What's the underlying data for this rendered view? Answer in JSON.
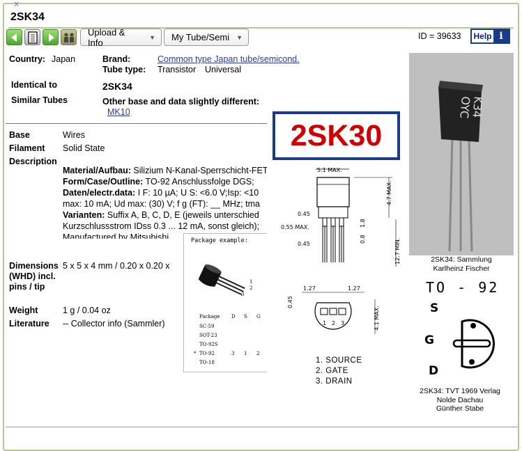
{
  "title": "2SK34",
  "nav": {
    "upload_label": "Upload & Info",
    "mytube_label": "My Tube/Semi",
    "id_text": "ID = 39633",
    "help_label": "Help",
    "help_icon_glyph": "i",
    "icons": [
      "arrow-left-icon",
      "document-icon",
      "arrow-right-icon",
      "people-icon"
    ]
  },
  "info": {
    "country_label": "Country:",
    "country_value": "Japan",
    "brand_label": "Brand:",
    "brand_value": "Common type Japan tube/semicond.",
    "tubetype_label": "Tube type:",
    "tubetype_value": "Transistor",
    "tubetype_value2": "Universal",
    "identical_label": "Identical to",
    "identical_value": "2SK34",
    "similar_label": "Similar Tubes",
    "similar_text": "Other base and data slightly different:",
    "similar_link": "MK10"
  },
  "details": {
    "base_label": "Base",
    "base_value": "Wires",
    "filament_label": "Filament",
    "filament_value": "Solid State",
    "description_label": "Description",
    "desc_lines": [
      {
        "b": "Material/Aufbau:",
        "t": " Silizium N-Kanal-Sperrschicht-FET"
      },
      {
        "b": "Form/Case/Outline:",
        "t": " TO-92 Anschlussfolge DGS;"
      },
      {
        "b": "Daten/electr.data:",
        "t": " I F: 10 µA; U S: <6.0 V;Isp: <10"
      },
      {
        "b": "",
        "t": "max: 10 mA; Ud max: (30) V; f g (FT): __ MHz; tma"
      },
      {
        "b": "Varianten:",
        "t": " Suffix A, B, C, D, E (jeweils unterschied"
      },
      {
        "b": "",
        "t": "Kurzschlussstrom IDss 0.3 ... 12 mA, sonst gleich);"
      },
      {
        "b": "",
        "t": "Manufactured by Mitsubishi"
      }
    ],
    "dimensions_label": "Dimensions (WHD) incl. pins / tip",
    "dimensions_value": "5 x 5 x 4 mm / 0.20 x 0.20 x",
    "weight_label": "Weight",
    "weight_value": "1 g / 0.04 oz",
    "literature_label": "Literature",
    "literature_value": "-- Collector info (Sammler)"
  },
  "package_example": {
    "title": "Package example:",
    "header": [
      "Package",
      "D",
      "S",
      "G"
    ],
    "rows": [
      {
        "mark": "",
        "name": "SC-59",
        "d": "",
        "s": "",
        "g": ""
      },
      {
        "mark": "",
        "name": "SOT-23",
        "d": "",
        "s": "",
        "g": ""
      },
      {
        "mark": "",
        "name": "TO-92S",
        "d": "",
        "s": "",
        "g": ""
      },
      {
        "mark": "*",
        "name": "TO-92",
        "d": "3",
        "s": "1",
        "g": "2"
      },
      {
        "mark": "",
        "name": "TO-18",
        "d": "",
        "s": "",
        "g": ""
      }
    ],
    "pin_labels": [
      "1",
      "2",
      "3"
    ]
  },
  "datasheet": {
    "title": "2SK30",
    "dims": [
      "5.1 MAX.",
      "4.7 MAX.",
      "0.45",
      "0.55 MAX.",
      "1.8",
      "0.8",
      "0.45",
      "12.7 MIN.",
      "1.27",
      "1.27",
      "0.45",
      "4.1 MAX."
    ],
    "pin_nums": [
      "1",
      "2",
      "3"
    ],
    "pins": [
      "1.  SOURCE",
      "2.  GATE",
      "3.  DRAIN"
    ]
  },
  "photo": {
    "marking_line1": "K34",
    "marking_line2": "OYC",
    "caption_line1": "2SK34: Sammlung",
    "caption_line2": "Karlheinz Fischer"
  },
  "to92": {
    "title": "TO - 92",
    "s": "S",
    "g": "G",
    "d": "D",
    "caption_line1": "2SK34: TVT 1969 Verlag",
    "caption_line2": "Nolde Dachau",
    "caption_line3": "Günther Stabe"
  },
  "colors": {
    "frame_green": "#b4c89a",
    "link_blue": "#2a3aa8",
    "help_navy": "#1a3a8a",
    "datasheet_red": "#d00000"
  }
}
